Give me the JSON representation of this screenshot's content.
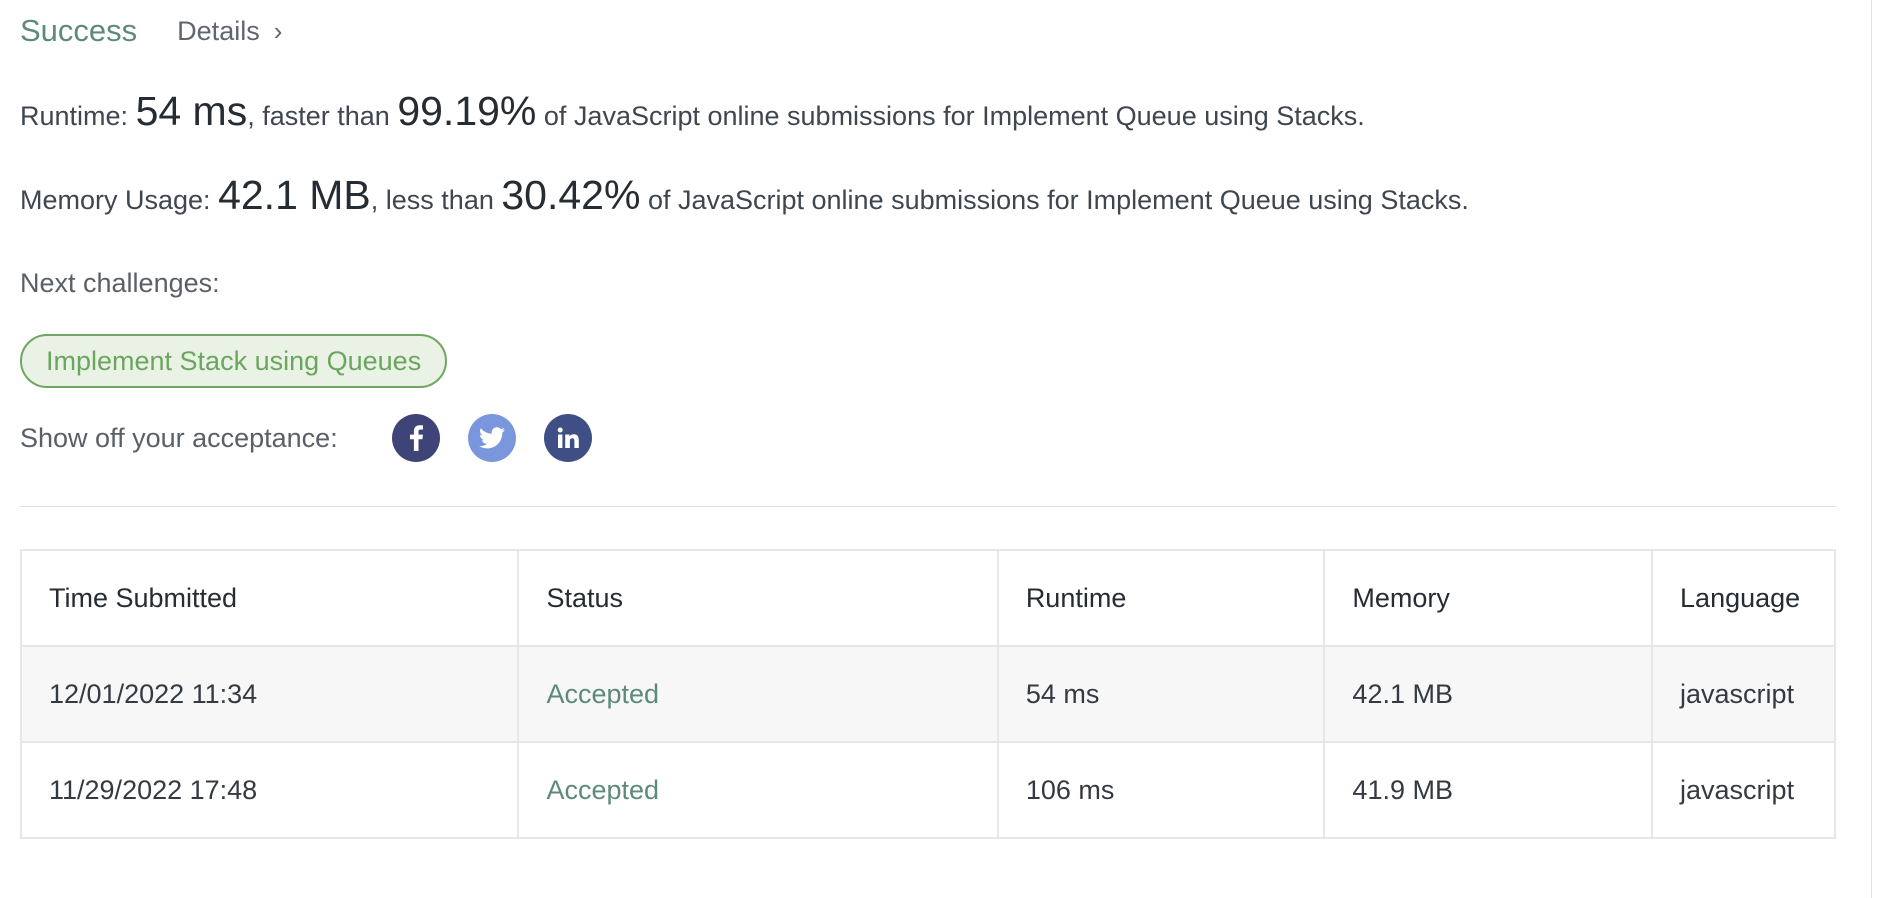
{
  "header": {
    "status": "Success",
    "details_label": "Details",
    "details_chevron": "›"
  },
  "runtime": {
    "label": "Runtime:",
    "value": "54 ms",
    "comparison": ", faster than",
    "percent": "99.19%",
    "suffix": "of JavaScript online submissions for Implement Queue using Stacks."
  },
  "memory": {
    "label": "Memory Usage:",
    "value": "42.1 MB",
    "comparison": ", less than",
    "percent": "30.42%",
    "suffix": "of JavaScript online submissions for Implement Queue using Stacks."
  },
  "next": {
    "label": "Next challenges:",
    "challenges": [
      "Implement Stack using Queues"
    ]
  },
  "share": {
    "label": "Show off your acceptance:",
    "icons": [
      "facebook-icon",
      "twitter-icon",
      "linkedin-icon"
    ]
  },
  "table": {
    "headers": [
      "Time Submitted",
      "Status",
      "Runtime",
      "Memory",
      "Language"
    ],
    "rows": [
      {
        "time": "12/01/2022 11:34",
        "status": "Accepted",
        "runtime": "54 ms",
        "memory": "42.1 MB",
        "language": "javascript"
      },
      {
        "time": "11/29/2022 17:48",
        "status": "Accepted",
        "runtime": "106 ms",
        "memory": "41.9 MB",
        "language": "javascript"
      }
    ]
  },
  "colors": {
    "success": "#5d8a7c",
    "challenge_border": "#6fa661",
    "challenge_bg": "#eaf2e6",
    "facebook": "#3f4478",
    "twitter": "#7a97dd",
    "linkedin": "#3f4f86"
  }
}
